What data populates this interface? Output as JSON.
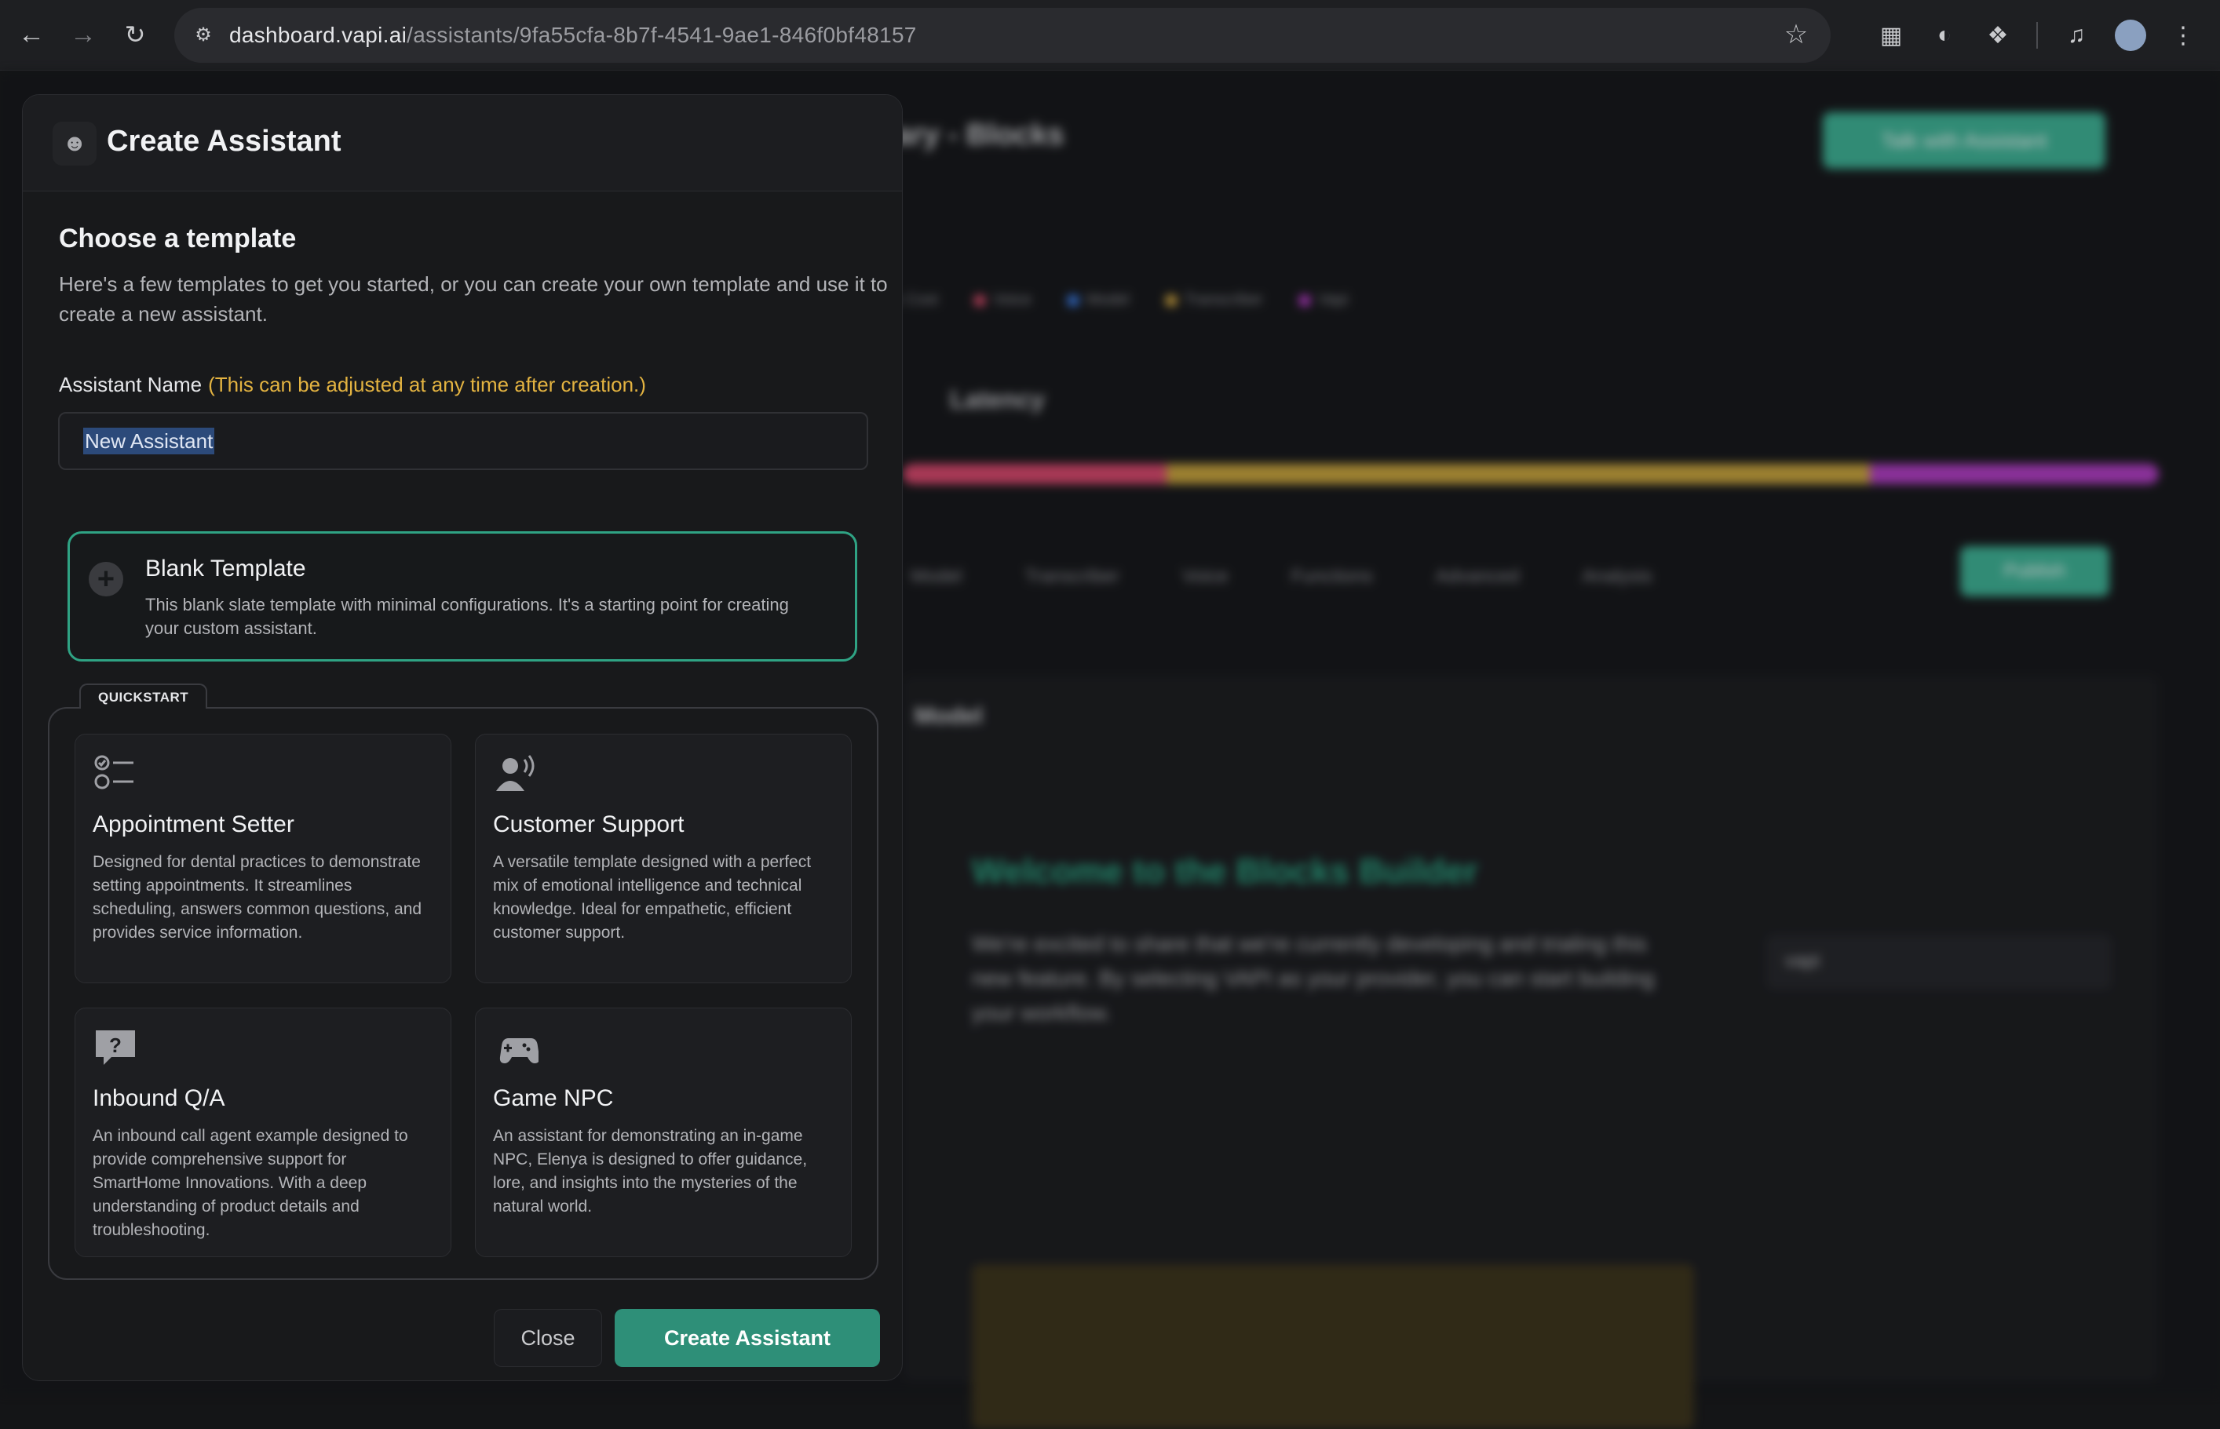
{
  "browser": {
    "url_host": "dashboard.vapi.ai",
    "url_path": "/assistants/9fa55cfa-8b7f-4541-9ae1-846f0bf48157"
  },
  "background_app": {
    "title": "ary - Blocks",
    "talk_button": "Talk with Assistant",
    "legend": [
      "Cost",
      "Voice",
      "Model",
      "Transcriber",
      "Vapi"
    ],
    "latency_label": "Latency",
    "tabs": [
      "Model",
      "Transcriber",
      "Voice",
      "Functions",
      "Advanced",
      "Analysis"
    ],
    "publish_button": "Publish",
    "model_heading": "Model",
    "welcome_heading": "Welcome to the Blocks Builder",
    "welcome_text": "We're excited to share that we're currently developing and trialing this new feature. By selecting VAPI as your provider, you can start building your workflow.",
    "provider_value": "vapi"
  },
  "modal": {
    "title": "Create Assistant",
    "choose_title": "Choose a template",
    "choose_desc": "Here's a few templates to get you started, or you can create your own template and use it to create a new assistant.",
    "name_label": "Assistant Name",
    "name_hint": "(This can be adjusted at any time after creation.)",
    "name_value": "New Assistant",
    "blank": {
      "title": "Blank Template",
      "desc": "This blank slate template with minimal configurations. It's a starting point for creating your custom assistant."
    },
    "quickstart_label": "QUICKSTART",
    "templates": [
      {
        "icon": "checklist-icon",
        "title": "Appointment Setter",
        "desc": "Designed for dental practices to demonstrate setting appointments. It streamlines scheduling, answers common questions, and provides service information."
      },
      {
        "icon": "speaking-person-icon",
        "title": "Customer Support",
        "desc": "A versatile template designed with a perfect mix of emotional intelligence and technical knowledge. Ideal for empathetic, efficient customer support."
      },
      {
        "icon": "question-bubble-icon",
        "title": "Inbound Q/A",
        "desc": "An inbound call agent example designed to provide comprehensive support for SmartHome Innovations. With a deep understanding of product details and troubleshooting."
      },
      {
        "icon": "gamepad-icon",
        "title": "Game NPC",
        "desc": "An assistant for demonstrating an in-game NPC, Elenya is designed to offer guidance, lore, and insights into the mysteries of the natural world."
      }
    ],
    "close_label": "Close",
    "create_label": "Create Assistant"
  },
  "colors": {
    "accent": "#2fa384",
    "hint": "#e3b341",
    "button": "#2e8f78"
  }
}
